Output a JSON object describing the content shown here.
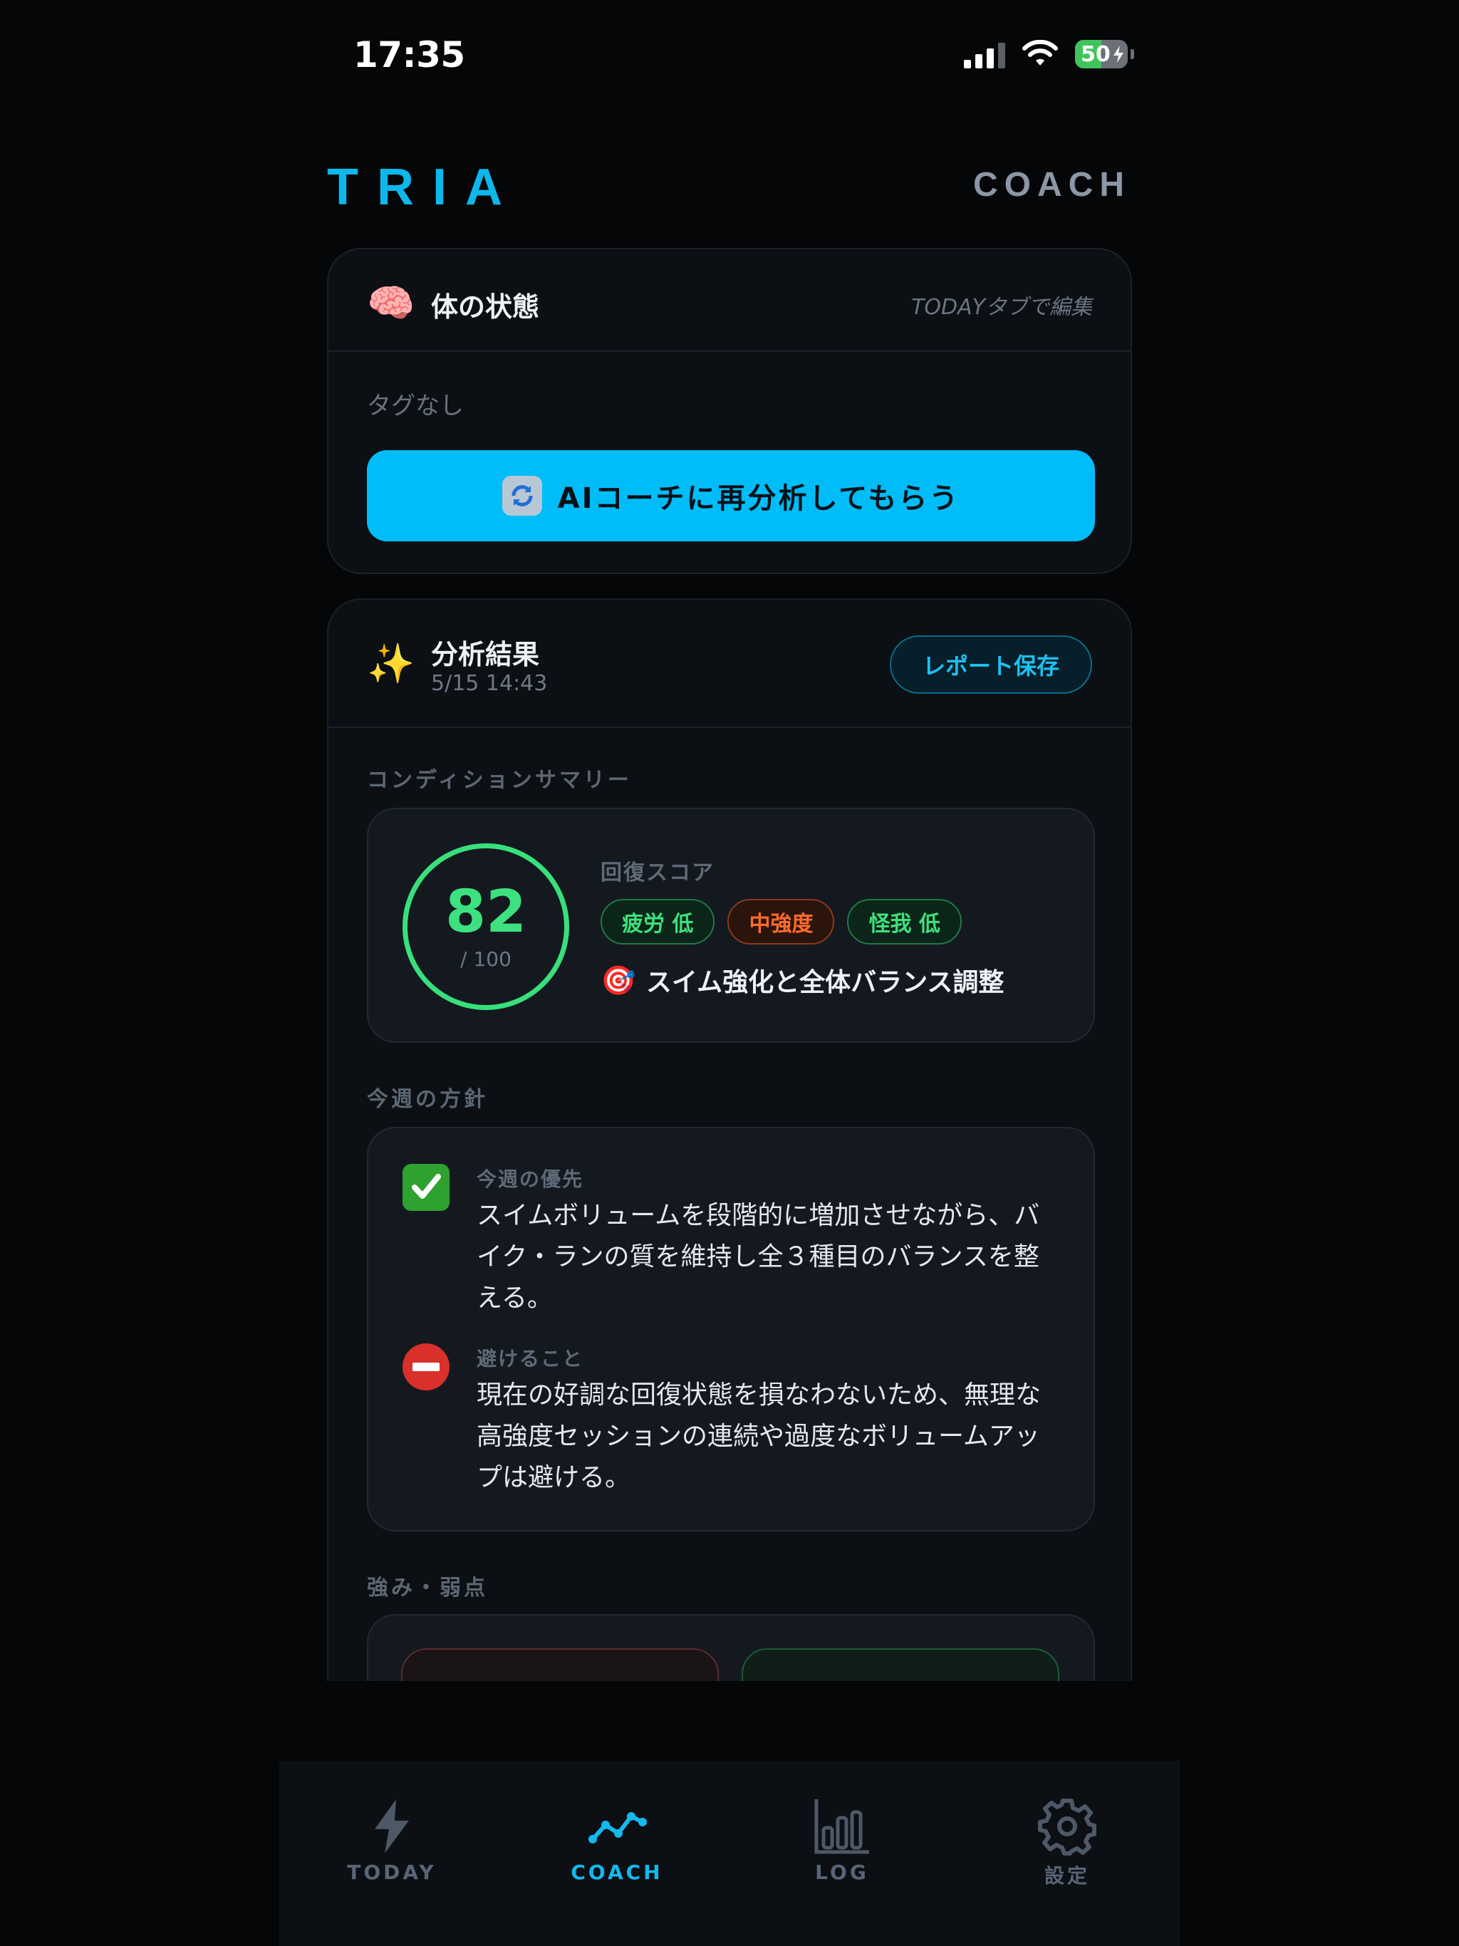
{
  "status_bar": {
    "time": "17:35",
    "battery": "50"
  },
  "header": {
    "logo": "TRIA",
    "section": "COACH"
  },
  "body_state": {
    "emoji": "🧠",
    "title": "体の状態",
    "hint": "TODAYタブで編集",
    "tags_empty": "タグなし",
    "reanalyze_label": "AIコーチに再分析してもらう"
  },
  "analysis": {
    "emoji": "✨",
    "title": "分析結果",
    "date": "5/15 14:43",
    "save_label": "レポート保存",
    "summary_label": "コンディションサマリー",
    "score": "82",
    "score_max": "/ 100",
    "recovery_label": "回復スコア",
    "chips": [
      {
        "label": "疲労 低",
        "tone": "green"
      },
      {
        "label": "中強度",
        "tone": "orange"
      },
      {
        "label": "怪我 低",
        "tone": "green"
      }
    ],
    "focus_emoji": "🎯",
    "focus": "スイム強化と全体バランス調整",
    "policy_label": "今週の方針",
    "priority_head": "今週の優先",
    "priority_text": "スイムボリュームを段階的に増加させながら、バイク・ランの質を維持し全３種目のバランスを整える。",
    "avoid_head": "避けること",
    "avoid_text": "現在の好調な回復状態を損なわないため、無理な高強度セッションの連続や過度なボリュームアップは避ける。",
    "sw_label": "強み・弱点"
  },
  "tabs": [
    {
      "label": "TODAY",
      "icon": "bolt-icon",
      "active": false
    },
    {
      "label": "COACH",
      "icon": "trend-icon",
      "active": true
    },
    {
      "label": "LOG",
      "icon": "bar-chart-icon",
      "active": false
    },
    {
      "label": "設定",
      "icon": "gear-icon",
      "active": false
    }
  ],
  "colors": {
    "accent": "#0db7ec",
    "score": "#3ee17f",
    "warning": "#ff6a2b",
    "background": "#050608"
  }
}
